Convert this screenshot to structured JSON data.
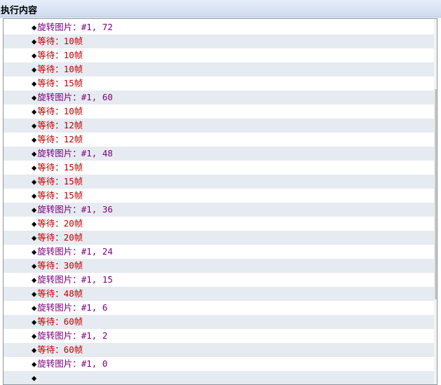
{
  "header": {
    "title": "执行内容"
  },
  "list": {
    "marker_icon": "diamond-bullet-icon",
    "colors": {
      "rotate": "#800080",
      "wait": "#c00000",
      "marker": "#000000",
      "alt_row": "#e6ebf1"
    },
    "rows": [
      {
        "type": "rotate",
        "text": "旋转图片：#1, 72"
      },
      {
        "type": "wait",
        "text": "等待：10帧"
      },
      {
        "type": "wait",
        "text": "等待：10帧"
      },
      {
        "type": "wait",
        "text": "等待：10帧"
      },
      {
        "type": "wait",
        "text": "等待：15帧"
      },
      {
        "type": "rotate",
        "text": "旋转图片：#1, 60"
      },
      {
        "type": "wait",
        "text": "等待：10帧"
      },
      {
        "type": "wait",
        "text": "等待：12帧"
      },
      {
        "type": "wait",
        "text": "等待：12帧"
      },
      {
        "type": "rotate",
        "text": "旋转图片：#1, 48"
      },
      {
        "type": "wait",
        "text": "等待：15帧"
      },
      {
        "type": "wait",
        "text": "等待：15帧"
      },
      {
        "type": "wait",
        "text": "等待：15帧"
      },
      {
        "type": "rotate",
        "text": "旋转图片：#1, 36"
      },
      {
        "type": "wait",
        "text": "等待：20帧"
      },
      {
        "type": "wait",
        "text": "等待：20帧"
      },
      {
        "type": "rotate",
        "text": "旋转图片：#1, 24"
      },
      {
        "type": "wait",
        "text": "等待：30帧"
      },
      {
        "type": "rotate",
        "text": "旋转图片：#1, 15"
      },
      {
        "type": "wait",
        "text": "等待：48帧"
      },
      {
        "type": "rotate",
        "text": "旋转图片：#1, 6"
      },
      {
        "type": "wait",
        "text": "等待：60帧"
      },
      {
        "type": "rotate",
        "text": "旋转图片：#1, 2"
      },
      {
        "type": "wait",
        "text": "等待：60帧"
      },
      {
        "type": "rotate",
        "text": "旋转图片：#1, 0"
      },
      {
        "type": "empty",
        "text": ""
      }
    ]
  }
}
